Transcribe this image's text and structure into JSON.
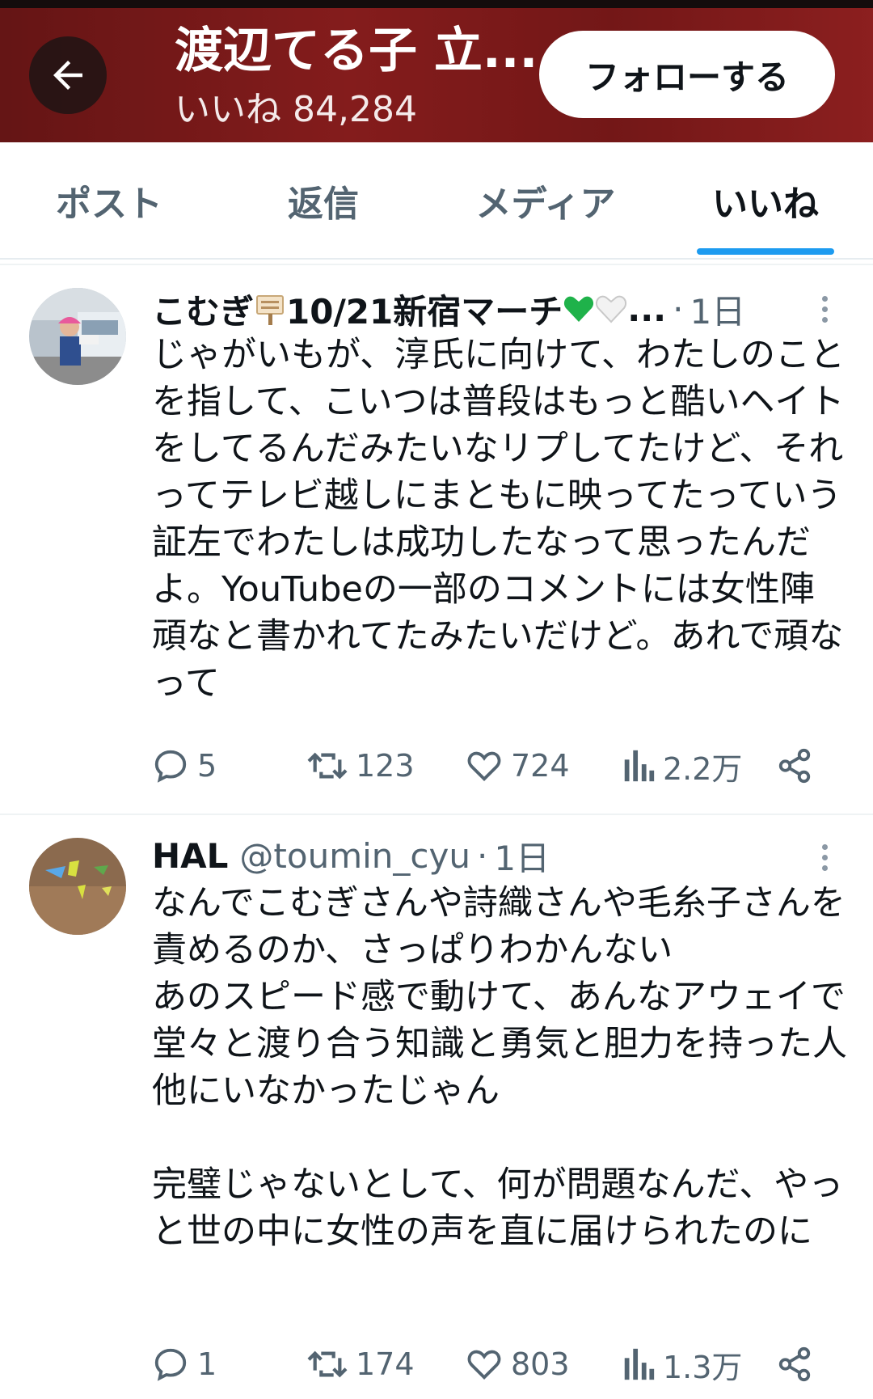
{
  "header": {
    "title": "渡辺てる子 立...",
    "subtitle": "いいね 84,284",
    "follow_label": "フォローする",
    "back_icon": "arrow-left-icon"
  },
  "tabs": [
    {
      "label": "ポスト",
      "active": false
    },
    {
      "label": "返信",
      "active": false
    },
    {
      "label": "メディア",
      "active": false
    },
    {
      "label": "いいね",
      "active": true
    }
  ],
  "posts": [
    {
      "name_prefix": "こむぎ",
      "name_suffix": "10/21新宿マーチ",
      "name_ellipsis": "...",
      "handle": "",
      "time": "1日",
      "text": "じゃがいもが、淳氏に向けて、わたしのことを指して、こいつは普段はもっと酷いヘイトをしてるんだみたいなリプしてたけど、それってテレビ越しにまともに映ってたっていう証左でわたしは成功したなって思ったんだよ。YouTubeの一部のコメントには女性陣頑なと書かれてたみたいだけど。あれで頑なって",
      "replies": "5",
      "reposts": "123",
      "likes": "724",
      "views": "2.2万"
    },
    {
      "name_prefix": "HAL",
      "name_suffix": "",
      "name_ellipsis": "",
      "handle": "@toumin_cyu",
      "time": "1日",
      "text": "なんでこむぎさんや詩織さんや毛糸子さんを責めるのか、さっぱりわかんない\nあのスピード感で動けて、あんなアウェイで堂々と渡り合う知識と勇気と胆力を持った人他にいなかったじゃん\n\n完璧じゃないとして、何が問題なんだ、やっと世の中に女性の声を直に届けられたのに",
      "replies": "1",
      "reposts": "174",
      "likes": "803",
      "views": "1.3万"
    }
  ],
  "colors": {
    "accent": "#1d9bf0",
    "text_primary": "#0f1419",
    "text_secondary": "#536471",
    "banner": "#a62626"
  }
}
